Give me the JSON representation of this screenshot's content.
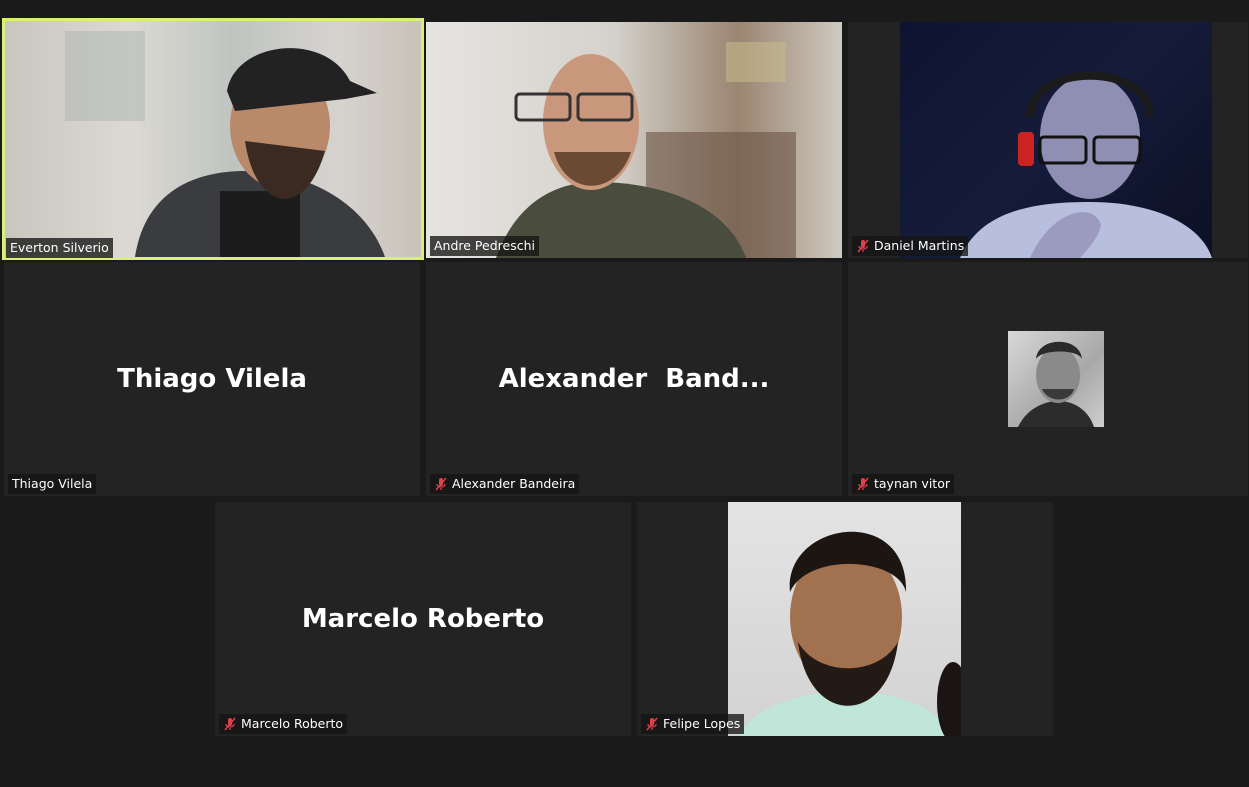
{
  "participants": [
    {
      "name": "Everton Silverio",
      "muted": false,
      "active": true
    },
    {
      "name": "Andre Pedreschi",
      "muted": false,
      "active": false
    },
    {
      "name": "Daniel Martins",
      "muted": true,
      "active": false
    },
    {
      "name": "Thiago Vilela",
      "tile_text": "Thiago Vilela",
      "muted": false
    },
    {
      "name": "Alexander Bandeira",
      "tile_text": "Alexander  Band...",
      "muted": true
    },
    {
      "name": "taynan vitor",
      "muted": true
    },
    {
      "name": "Marcelo Roberto",
      "tile_text": "Marcelo Roberto",
      "muted": true
    },
    {
      "name": "Felipe Lopes",
      "muted": true
    }
  ],
  "colors": {
    "background": "#1a1a1a",
    "tile": "#232323",
    "active_border": "#d8ef7a",
    "muted_icon": "#e0404a"
  },
  "icons": {
    "muted": "mic-muted-icon"
  }
}
